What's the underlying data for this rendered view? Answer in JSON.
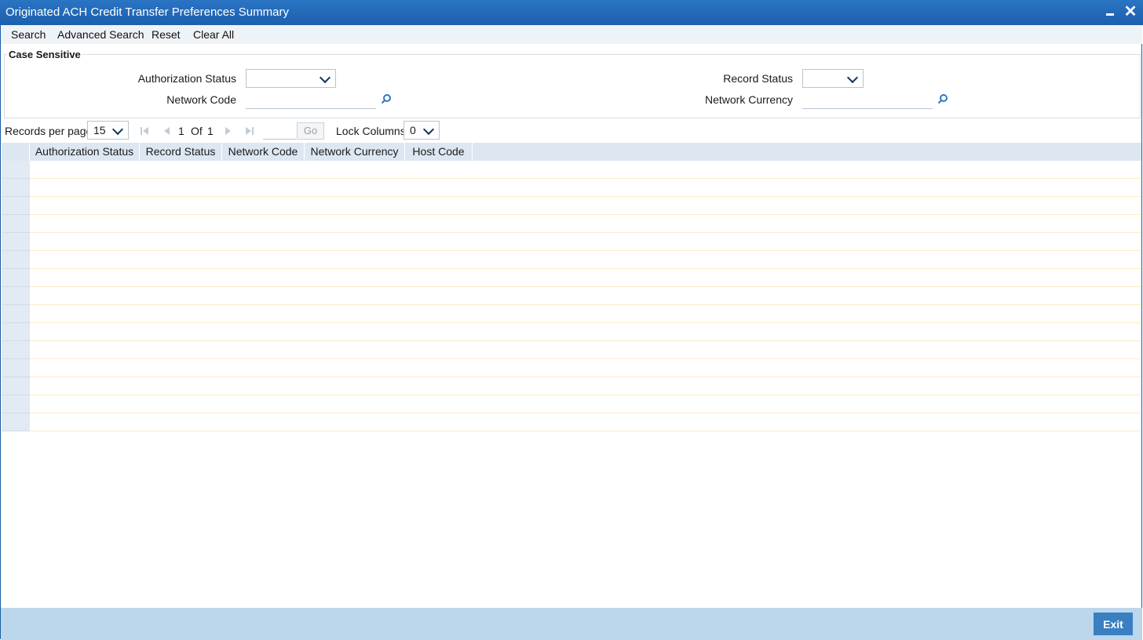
{
  "window": {
    "title": "Originated ACH Credit Transfer Preferences Summary"
  },
  "menu": {
    "items": [
      "Search",
      "Advanced Search",
      "Reset",
      "Clear All"
    ]
  },
  "criteria": {
    "legend": "Case Sensitive",
    "authorization_status_label": "Authorization Status",
    "authorization_status_value": "",
    "record_status_label": "Record Status",
    "record_status_value": "",
    "network_code_label": "Network Code",
    "network_code_value": "",
    "network_currency_label": "Network Currency",
    "network_currency_value": ""
  },
  "pager": {
    "records_per_page_label": "Records per page",
    "records_per_page_value": "15",
    "current_page": "1",
    "of_label": "Of",
    "total_pages": "1",
    "go_label": "Go",
    "lock_columns_label": "Lock Columns",
    "lock_columns_value": "0"
  },
  "grid": {
    "columns": [
      "Authorization Status",
      "Record Status",
      "Network Code",
      "Network Currency",
      "Host Code"
    ],
    "row_count": 15
  },
  "footer": {
    "exit_label": "Exit"
  },
  "colors": {
    "titlebar": "#1c5fad",
    "grid_header": "#dde7f2",
    "footer": "#bcd6ec",
    "exit_button": "#3a7fc0"
  }
}
